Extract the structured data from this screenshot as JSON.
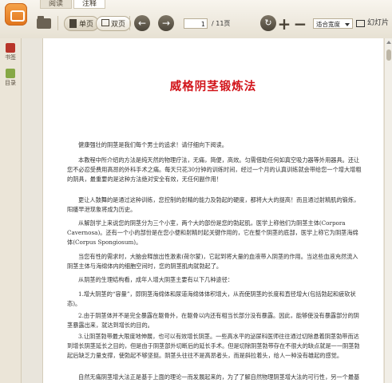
{
  "tabs": [
    {
      "label": "阅读"
    },
    {
      "label": "注释"
    }
  ],
  "toolbar": {
    "single_page": "单页",
    "double_page": "双页",
    "page_current": "1",
    "page_total": "/ 11页",
    "zoom_in": "+",
    "zoom_out": "−",
    "fit_mode": "适合宽度",
    "slideshow": "幻灯片"
  },
  "sidebar": [
    {
      "label": "书签"
    },
    {
      "label": "目录"
    }
  ],
  "document": {
    "title": "威格阴茎锻炼法",
    "paragraphs": [
      "健康强壮的阴茎是我们每个男士的追求！请仔细向下阅读。",
      "本教程中所介绍的方法是纯天然的物理疗法，无痛，简便，高效。匀需借助任何如真空吸力器等外用器具。还让您不必忍受费用高昂的外科手术之痛。每天只花30分钟的训练时间，经过一个月的认真训练就会带给您一个增大增粗的阴具，最重要的是这种方法绝对安全有效，无任何副作用！",
      "更让人鼓舞的是通过这种训练，您控制的射精的能力及勃起的硬度，都将大大的提高！而且通过射精肌的锻炼，阳痿早泄现象将成为历史。",
      "从解剖学上来说您的阴茎分为三个小室，两个大的部份是您的勃起肌，医学上称他们为阴茎主体(Corpora Cavernosa)。还有一个小的部份是在您小便和射精时起关键作用的，它在整个阴茎的底部，医学上称它为阴茎海绵体(Corpus Spongiosum)。",
      "当您有性的需求时，大脑会释放出性激素(荷尔蒙)，它起到将大量的血液带入阴茎的作用。当这些血液充然流入阴茎主体与海绵体内的细胞空间时，您的阴茎肌肉就勃起了。",
      "从阴茎的生理结构看，成年人增大阴茎主要有以下几种途径：",
      "1.增大阴茎的“容量”，即阴茎海绵体和尿道海绵体体积增大，从而使阴茎的长度和直径增大(包括勃起和疲软状态)。",
      "2.由于阴茎体并不是完全暴露在躯骨外，在躯骨以内还有相当长部分没有暴露。因此，能够使没有暴露部分的阴茎暴露出来，就达到增长的目的。",
      "3.让阴茎勃带最大限度地伸展，也可以有效增长阴茎。一些高水平的泌尿科医师往往通过切除悬着阴茎勃带而达到增长阴茎延长之目的，但是由于阴茎部外切断后的延长手术。但是切除阴茎勃带存在不很大的缺点就是一一阴茎勃起后缺乏力量支撑，使勃起不够坚挺。阴茎头往往不是高昂者头，而是斜拉着头，给人一种没有雄起的感觉。",
      "自然无痛阴茎增大法正是基于上面的理论一而发展起来的，为了了解自然物理阴茎增大法的可行性，另一个最基本的概念大家应该知道，那就是肌肉细胞。本质上来说，您的阴茎肌肉与身体上很多如三头肌，四头肌，胸肌是相同的。"
    ]
  }
}
